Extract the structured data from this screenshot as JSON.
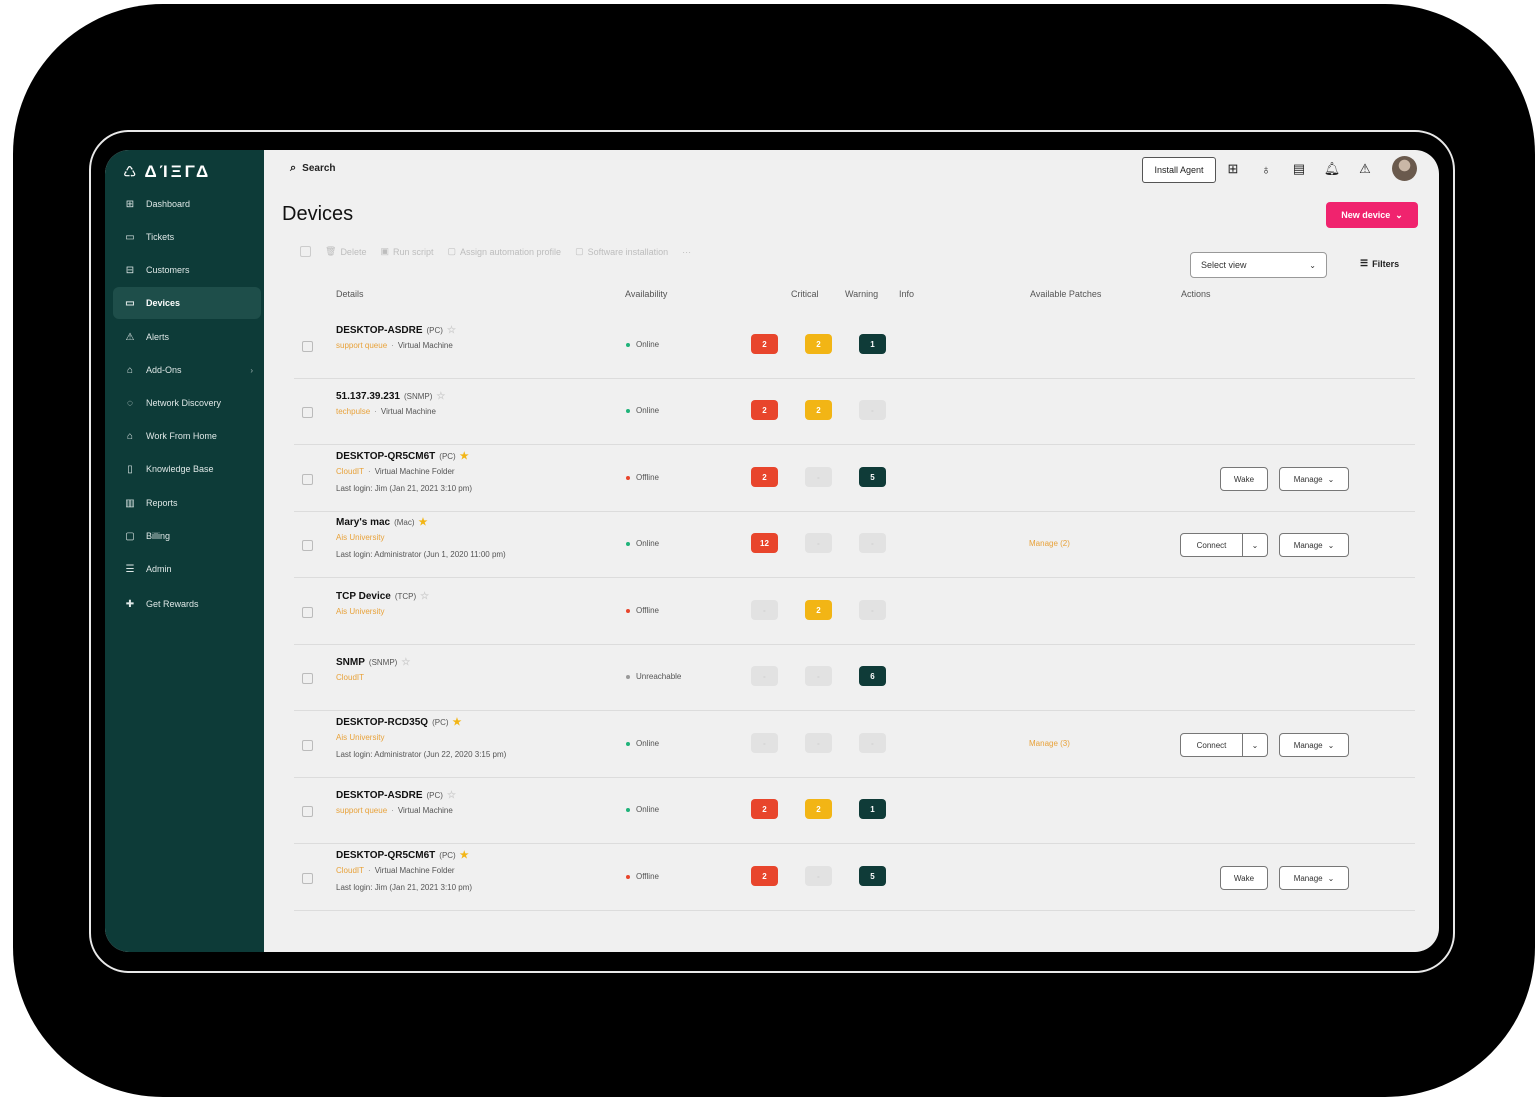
{
  "app": {
    "brand": "ΔΊΞΓΔ",
    "logo_icon": "recycle-icon"
  },
  "sidebar": {
    "items": [
      {
        "label": "Dashboard",
        "icon": "dashboard-icon"
      },
      {
        "label": "Tickets",
        "icon": "ticket-icon"
      },
      {
        "label": "Customers",
        "icon": "customers-icon"
      },
      {
        "label": "Devices",
        "icon": "monitor-icon",
        "active": true
      },
      {
        "label": "Alerts",
        "icon": "alert-icon"
      },
      {
        "label": "Add-Ons",
        "icon": "addons-icon",
        "has_submenu": true
      },
      {
        "label": "Network Discovery",
        "icon": "network-icon"
      },
      {
        "label": "Work From Home",
        "icon": "home-icon"
      },
      {
        "label": "Knowledge Base",
        "icon": "book-icon"
      },
      {
        "label": "Reports",
        "icon": "reports-icon"
      },
      {
        "label": "Billing",
        "icon": "billing-icon"
      },
      {
        "label": "Admin",
        "icon": "admin-icon"
      },
      {
        "label": "Get Rewards",
        "icon": "gift-icon"
      }
    ]
  },
  "topbar": {
    "search_label": "Search",
    "install_agent": "Install Agent",
    "icons": [
      "plus-icon",
      "lightbulb-icon",
      "notes-icon",
      "bell-icon",
      "warning-icon"
    ]
  },
  "page": {
    "title": "Devices",
    "new_device": "New device",
    "bulk_actions": [
      "Delete",
      "Run script",
      "Assign automation profile",
      "Software installation",
      "···"
    ],
    "select_view": "Select view",
    "filters": "Filters"
  },
  "table": {
    "headers": {
      "details": "Details",
      "availability": "Availability",
      "critical": "Critical",
      "warning": "Warning",
      "info": "Info",
      "patches": "Available Patches",
      "actions": "Actions"
    },
    "rows": [
      {
        "name": "DESKTOP-ASDRE",
        "type": "(PC)",
        "starred": false,
        "customer": "support queue",
        "sep": "·",
        "kind": "Virtual Machine",
        "last_login": "",
        "availability": "Online",
        "critical": "2",
        "warning": "2",
        "info": "1",
        "patches": "",
        "actions": []
      },
      {
        "name": "51.137.39.231",
        "type": "(SNMP)",
        "starred": false,
        "customer": "techpulse",
        "sep": "·",
        "kind": "Virtual Machine",
        "last_login": "",
        "availability": "Online",
        "critical": "2",
        "warning": "2",
        "info": "",
        "patches": "",
        "actions": []
      },
      {
        "name": "DESKTOP-QR5CM6T",
        "type": "(PC)",
        "starred": true,
        "customer": "CloudIT",
        "sep": "·",
        "kind": "Virtual Machine Folder",
        "last_login": "Last login: Jim (Jan 21, 2021 3:10 pm)",
        "availability": "Offline",
        "critical": "2",
        "warning": "",
        "info": "5",
        "patches": "",
        "actions": [
          "Wake",
          "Manage"
        ]
      },
      {
        "name": "Mary's mac",
        "type": "(Mac)",
        "starred": true,
        "customer": "Ais University",
        "sep": "",
        "kind": "",
        "last_login": "Last login: Administrator (Jun 1, 2020 11:00 pm)",
        "availability": "Online",
        "critical": "12",
        "warning": "",
        "info": "",
        "patches": "Manage (2)",
        "actions": [
          "Connect",
          "Manage"
        ]
      },
      {
        "name": "TCP Device",
        "type": "(TCP)",
        "starred": false,
        "customer": "Ais University",
        "sep": "",
        "kind": "",
        "last_login": "",
        "availability": "Offline",
        "critical": "",
        "warning": "2",
        "info": "",
        "patches": "",
        "actions": []
      },
      {
        "name": "SNMP",
        "type": "(SNMP)",
        "starred": false,
        "customer": "CloudIT",
        "sep": "",
        "kind": "",
        "last_login": "",
        "availability": "Unreachable",
        "critical": "",
        "warning": "",
        "info": "6",
        "patches": "",
        "actions": []
      },
      {
        "name": "DESKTOP-RCD35Q",
        "type": "(PC)",
        "starred": true,
        "customer": "Ais University",
        "sep": "",
        "kind": "",
        "last_login": "Last login: Administrator (Jun 22, 2020 3:15 pm)",
        "availability": "Online",
        "critical": "",
        "warning": "",
        "info": "",
        "patches": "Manage (3)",
        "actions": [
          "Connect",
          "Manage"
        ]
      },
      {
        "name": "DESKTOP-ASDRE",
        "type": "(PC)",
        "starred": false,
        "customer": "support queue",
        "sep": "·",
        "kind": "Virtual Machine",
        "last_login": "",
        "availability": "Online",
        "critical": "2",
        "warning": "2",
        "info": "1",
        "patches": "",
        "actions": []
      },
      {
        "name": "DESKTOP-QR5CM6T",
        "type": "(PC)",
        "starred": true,
        "customer": "CloudIT",
        "sep": "·",
        "kind": "Virtual Machine Folder",
        "last_login": "Last login: Jim (Jan 21, 2021 3:10 pm)",
        "availability": "Offline",
        "critical": "2",
        "warning": "",
        "info": "5",
        "patches": "",
        "actions": [
          "Wake",
          "Manage"
        ]
      }
    ]
  },
  "colors": {
    "sidebar": "#0d3b38",
    "accent": "#f0236e",
    "critical": "#e8452c",
    "warning": "#f2b515",
    "info": "#0f3b38",
    "online": "#1fb37a",
    "offline": "#e8452c",
    "unreachable": "#9a9a9a"
  }
}
